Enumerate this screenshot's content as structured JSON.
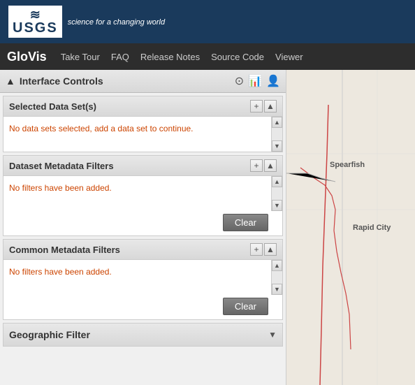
{
  "usgs": {
    "logo_text": "USGS",
    "tagline": "science for a changing world"
  },
  "nav": {
    "title": "GloVis",
    "links": [
      "Take Tour",
      "FAQ",
      "Release Notes",
      "Source Code",
      "Viewer"
    ]
  },
  "interface_controls": {
    "title": "Interface Controls",
    "icons": [
      "dashboard-icon",
      "chart-icon",
      "user-settings-icon"
    ]
  },
  "selected_datasets": {
    "title": "Selected Data Set(s)",
    "message": "No data sets selected, add a data set to continue."
  },
  "dataset_metadata": {
    "title": "Dataset Metadata Filters",
    "message": "No filters have been added.",
    "clear_label": "Clear"
  },
  "common_metadata": {
    "title": "Common Metadata Filters",
    "message": "No filters have been added.",
    "clear_label": "Clear"
  },
  "geographic_filter": {
    "title": "Geographic Filter"
  },
  "map": {
    "label_spearfish": "Spearfish",
    "label_rapid_city": "Rapid City"
  }
}
